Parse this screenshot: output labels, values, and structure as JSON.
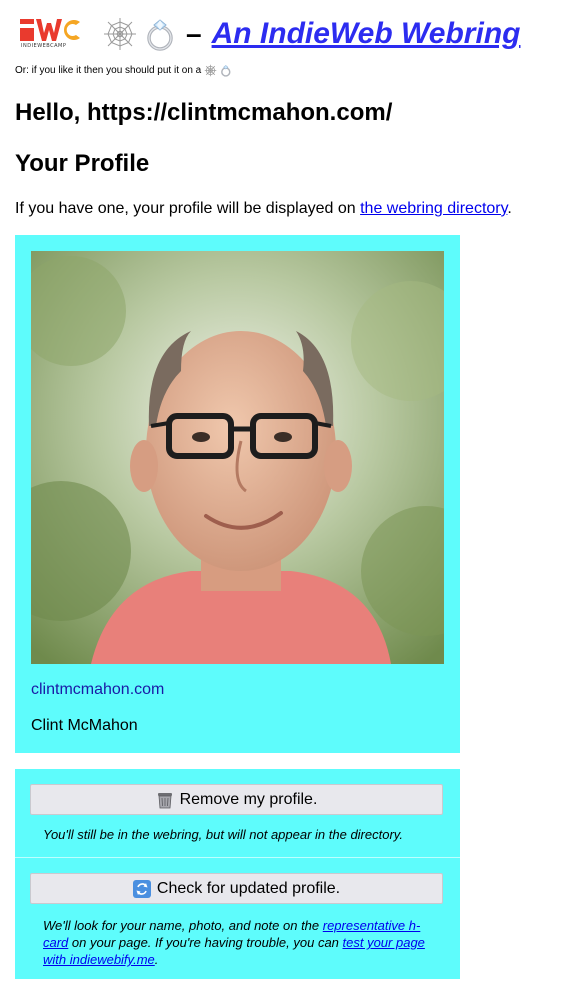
{
  "header": {
    "logo_caption": "INDIEWEBCAMP",
    "separator": "–",
    "title": "An IndieWeb Webring",
    "emoji_icons": [
      "spider-web-icon",
      "ring-icon"
    ]
  },
  "tagline": "Or: if you like it then you should put it on a",
  "greeting": "Hello, https://clintmcmahon.com/",
  "profile_heading": "Your Profile",
  "intro": {
    "before": "If you have one, your profile will be displayed on ",
    "link": "the webring directory",
    "after": "."
  },
  "profile": {
    "url": "clintmcmahon.com",
    "name": "Clint McMahon"
  },
  "actions": {
    "remove_label": "Remove my profile.",
    "remove_note": "You'll still be in the webring, but will not appear in the directory.",
    "check_label": "Check for updated profile.",
    "check_note_1": "We'll look for your name, photo, and note on the ",
    "check_note_link_1": "representative h-card",
    "check_note_2": " on your page. If you're having trouble, you can ",
    "check_note_link_2": "test your page with indiewebify.me",
    "check_note_3": "."
  },
  "colors": {
    "card_bg": "#5efcfc",
    "title_link": "#2c2cf0",
    "link": "#0000ee",
    "button_bg": "#e8e8ed",
    "iwc_red": "#e93a2e",
    "iwc_orange": "#f5a623"
  }
}
